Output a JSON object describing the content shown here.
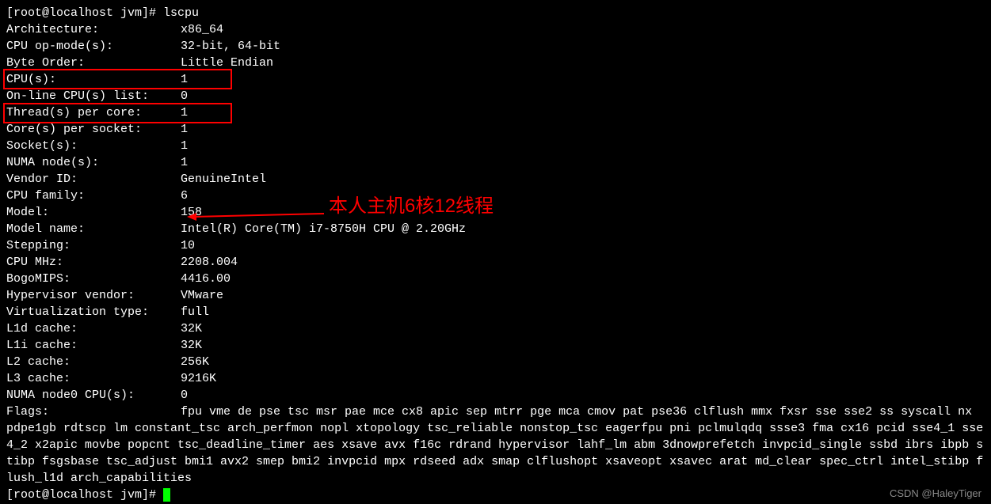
{
  "prompt1": "[root@localhost jvm]# ",
  "cmd": "lscpu",
  "rows": [
    {
      "k": "Architecture:",
      "v": "x86_64"
    },
    {
      "k": "CPU op-mode(s):",
      "v": "32-bit, 64-bit"
    },
    {
      "k": "Byte Order:",
      "v": "Little Endian"
    },
    {
      "k": "CPU(s):",
      "v": "1"
    },
    {
      "k": "On-line CPU(s) list:",
      "v": "0"
    },
    {
      "k": "Thread(s) per core:",
      "v": "1"
    },
    {
      "k": "Core(s) per socket:",
      "v": "1"
    },
    {
      "k": "Socket(s):",
      "v": "1"
    },
    {
      "k": "NUMA node(s):",
      "v": "1"
    },
    {
      "k": "Vendor ID:",
      "v": "GenuineIntel"
    },
    {
      "k": "CPU family:",
      "v": "6"
    },
    {
      "k": "Model:",
      "v": "158"
    },
    {
      "k": "Model name:",
      "v": "Intel(R) Core(TM) i7-8750H CPU @ 2.20GHz"
    },
    {
      "k": "Stepping:",
      "v": "10"
    },
    {
      "k": "CPU MHz:",
      "v": "2208.004"
    },
    {
      "k": "BogoMIPS:",
      "v": "4416.00"
    },
    {
      "k": "Hypervisor vendor:",
      "v": "VMware"
    },
    {
      "k": "Virtualization type:",
      "v": "full"
    },
    {
      "k": "L1d cache:",
      "v": "32K"
    },
    {
      "k": "L1i cache:",
      "v": "32K"
    },
    {
      "k": "L2 cache:",
      "v": "256K"
    },
    {
      "k": "L3 cache:",
      "v": "9216K"
    },
    {
      "k": "NUMA node0 CPU(s):",
      "v": "0"
    }
  ],
  "flags_label": "Flags:",
  "flags_value": "fpu vme de pse tsc msr pae mce cx8 apic sep mtrr pge mca cmov pat pse36 clflush mmx fxsr sse sse2 ss syscall nx pdpe1gb rdtscp lm constant_tsc arch_perfmon nopl xtopology tsc_reliable nonstop_tsc eagerfpu pni pclmulqdq ssse3 fma cx16 pcid sse4_1 sse4_2 x2apic movbe popcnt tsc_deadline_timer aes xsave avx f16c rdrand hypervisor lahf_lm abm 3dnowprefetch invpcid_single ssbd ibrs ibpb stibp fsgsbase tsc_adjust bmi1 avx2 smep bmi2 invpcid mpx rdseed adx smap clflushopt xsaveopt xsavec arat md_clear spec_ctrl intel_stibp flush_l1d arch_capabilities",
  "prompt2": "[root@localhost jvm]# ",
  "annotation": "本人主机6核12线程",
  "watermark": "CSDN @HaleyTiger"
}
